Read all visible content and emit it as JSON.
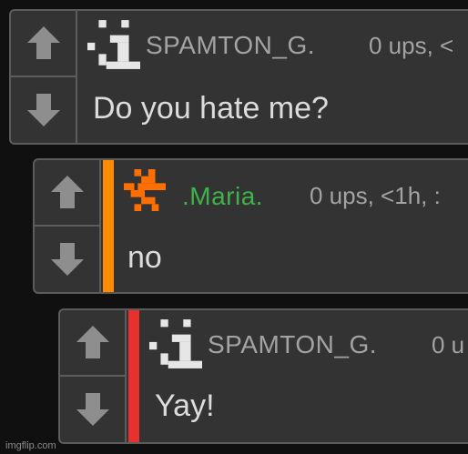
{
  "colors": {
    "background": "#101010",
    "panel": "#333333",
    "border": "#5c5c5c",
    "arrow": "#8e8e8e",
    "orange_bar": "#ff8c00",
    "red_bar": "#e8302c",
    "green_name": "#3fb34a",
    "orange_avatar": "#ff6f00"
  },
  "comments": [
    {
      "username": "SPAMTON_G.",
      "meta": "0 ups, <",
      "text": "Do you hate me?",
      "avatar_icon": "pixel-face-icon",
      "depth": 0
    },
    {
      "username": ".Maria.",
      "meta": "0 ups, <1h, :",
      "text": "no",
      "avatar_icon": "pixel-creature-icon",
      "depth": 1,
      "bar_color": "#ff8c00"
    },
    {
      "username": "SPAMTON_G.",
      "meta": "0 u",
      "text": "Yay!",
      "avatar_icon": "pixel-face-icon",
      "depth": 2,
      "bar_color": "#e8302c"
    }
  ],
  "watermark": "imgflip.com"
}
